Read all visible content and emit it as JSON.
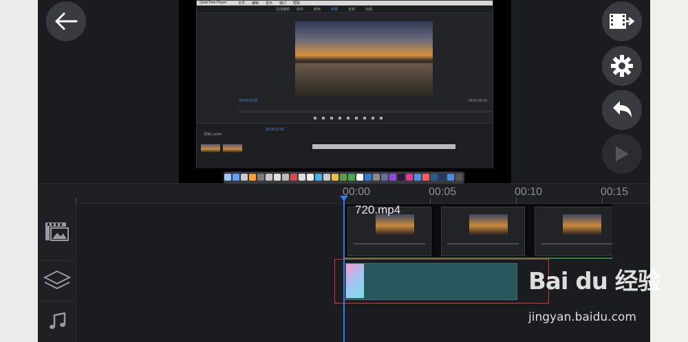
{
  "app": {
    "panel": "video-editor"
  },
  "preview": {
    "menubar": [
      "QuickTime Player",
      "文件",
      "编辑",
      "显示",
      "窗口",
      "帮助"
    ],
    "tabs": [
      {
        "label": "在线编辑",
        "active": false
      },
      {
        "label": "组件",
        "active": false
      },
      {
        "label": "颜色",
        "active": false
      },
      {
        "label": "效果",
        "active": true
      },
      {
        "label": "音频",
        "active": false
      },
      {
        "label": "标题",
        "active": false
      }
    ],
    "timecode_left": "00:00:12:03",
    "timecode_right": "00:01:00:14",
    "timeline_timecode": "00:00:12:03",
    "panel_label": "项目:Lucifer"
  },
  "toolbar": {
    "back_icon": "arrow-left-icon",
    "export_icon": "export-film-icon",
    "settings_icon": "gear-icon",
    "undo_icon": "undo-icon",
    "play_icon": "play-icon"
  },
  "ruler": {
    "ticks": [
      "00:00",
      "00:05",
      "00:10",
      "00:15"
    ]
  },
  "tracks": {
    "video_clip_name": "720.mp4",
    "side_icons": [
      "image-film-icon",
      "layers-icon",
      "music-note-icon"
    ]
  },
  "watermark": {
    "logo": "Bai du 经验",
    "url": "jingyan.baidu.com"
  },
  "colors": {
    "playhead": "#2f7df2",
    "overlay_clip": "#28575d",
    "highlight_box": "#e03232"
  }
}
